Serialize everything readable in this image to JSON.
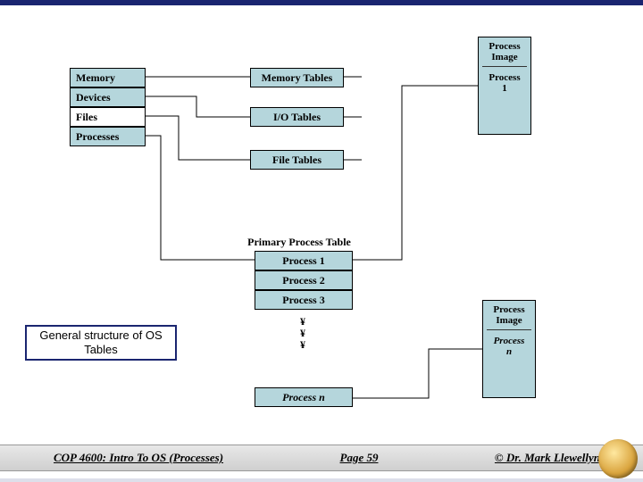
{
  "slide": {
    "caption": "General structure of OS Tables",
    "left_stack": {
      "memory": "Memory",
      "devices": "Devices",
      "files": "Files",
      "processes": "Processes"
    },
    "right_tables": {
      "memory_tables": "Memory Tables",
      "io_tables": "I/O Tables",
      "file_tables": "File Tables"
    },
    "ppt_title": "Primary Process Table",
    "ppt": {
      "p1": "Process 1",
      "p2": "Process 2",
      "p3": "Process 3",
      "pn": "Process n"
    },
    "dots": "¥\n¥\n¥",
    "image1": {
      "hdr": "Process\nImage",
      "sub": "Process\n1"
    },
    "imagen": {
      "hdr": "Process\nImage",
      "sub": "Process\nn"
    },
    "pn_style": "italic"
  },
  "footer": {
    "left": "COP 4600: Intro To OS  (Processes)",
    "center": "Page 59",
    "right": "© Dr. Mark Llewellyn"
  }
}
